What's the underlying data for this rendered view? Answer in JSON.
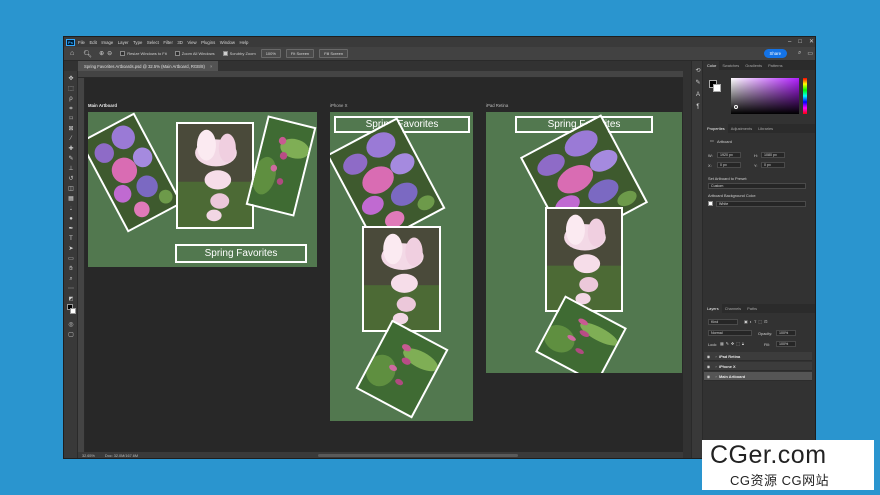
{
  "menubar": {
    "logo": "Ps",
    "items": [
      "File",
      "Edit",
      "Image",
      "Layer",
      "Type",
      "Select",
      "Filter",
      "3D",
      "View",
      "Plugins",
      "Window",
      "Help"
    ]
  },
  "options": {
    "resize_windows": "Resize Windows to Fit",
    "zoom_all": "Zoom All Windows",
    "scrubby_zoom": "Scrubby Zoom",
    "zoom_100": "100%",
    "fit_screen": "Fit Screen",
    "fill_screen": "Fill Screen",
    "share": "Share"
  },
  "document": {
    "tab": "Spring Favorites Artboards.psd @ 32.5% (Main Artboard, RGB/8)",
    "zoom": "32.65%",
    "doc_info": "Doc: 32.0M/167.6M"
  },
  "artboards": {
    "main_label": "Main Artboard",
    "iphone_label": "iPhone X",
    "ipad_label": "iPad Retina",
    "banner_text": "Spring Favorites"
  },
  "panels": {
    "color_tabs": [
      "Color",
      "Swatches",
      "Gradients",
      "Patterns"
    ],
    "props_tabs": [
      "Properties",
      "Adjustments",
      "Libraries"
    ],
    "props": {
      "section": "Artboard",
      "w_label": "W:",
      "w_value": "1920 px",
      "h_label": "H:",
      "h_value": "1080 px",
      "x_label": "X:",
      "x_value": "0 px",
      "y_label": "Y:",
      "y_value": "0 px",
      "preset_label": "Set Artboard to Preset:",
      "preset_value": "Custom",
      "bg_label": "Artboard Background Color:",
      "bg_value": "White"
    },
    "layers_tabs": [
      "Layers",
      "Channels",
      "Paths"
    ],
    "layers": {
      "kind": "Kind",
      "blend": "Normal",
      "opacity_label": "Opacity:",
      "opacity": "100%",
      "lock_label": "Lock:",
      "fill_label": "Fill:",
      "fill": "100%",
      "items": [
        "iPad Retina",
        "iPhone X",
        "Main Artboard"
      ]
    }
  },
  "watermark": {
    "main": "CGer.com",
    "sub": "CG资源 CG网站"
  },
  "colors": {
    "desktop": "#2a95cf",
    "artboard_green": "#52784f",
    "share_blue": "#1473e6"
  }
}
